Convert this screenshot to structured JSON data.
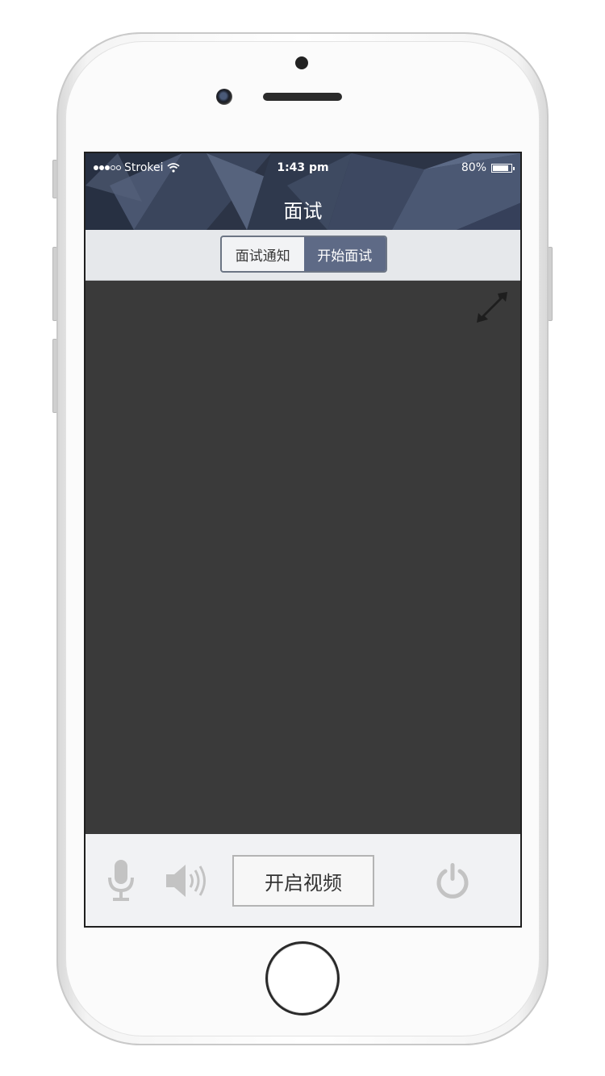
{
  "status_bar": {
    "carrier": "Strokei",
    "time": "1:43 pm",
    "battery": "80%"
  },
  "nav": {
    "title": "面试"
  },
  "tabs": [
    {
      "label": "面试通知",
      "active": false
    },
    {
      "label": "开始面试",
      "active": true
    }
  ],
  "controls": {
    "start_video_label": "开启视频",
    "mic_icon": "microphone-icon",
    "speaker_icon": "speaker-icon",
    "power_icon": "power-icon"
  },
  "colors": {
    "header_bg": "#2c3446",
    "active_tab": "#5e6a86",
    "video_bg": "#3a3a3a",
    "control_bar": "#f1f2f4"
  }
}
